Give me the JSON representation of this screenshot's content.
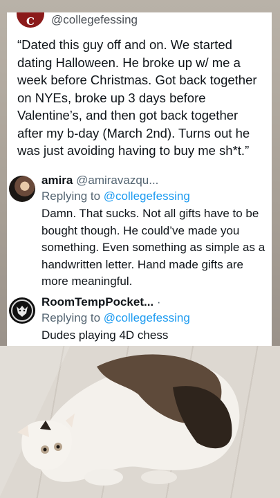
{
  "post": {
    "handle": "@collegefessing",
    "confession": "“Dated this guy off and on. We started dating Halloween. He broke up w/ me a week before Christmas. Got back together on NYEs, broke up 3 days before Valentine’s, and then got back together after my b-day (March 2nd). Turns out he was just avoiding having to buy me sh*t.”"
  },
  "replies": [
    {
      "name": "amira",
      "handle": "@amiravazqu...",
      "replying_prefix": "Replying to",
      "replying_to": "@collegefessing",
      "text": "Damn. That sucks. Not all gifts have to be bought though. He could’ve made you something. Even something as simple as a handwritten letter. Hand made gifts are more meaningful."
    },
    {
      "name": "RoomTempPocket...",
      "separator": " ·",
      "replying_prefix": "Replying to",
      "replying_to": "@collegefessing",
      "text": "Dudes playing 4D chess"
    }
  ],
  "colors": {
    "link": "#1d9bf0",
    "secondary_text": "#536471",
    "brand": "#8b1a1a"
  },
  "icons": {
    "avatar_2": "wolf-emblem-icon"
  }
}
